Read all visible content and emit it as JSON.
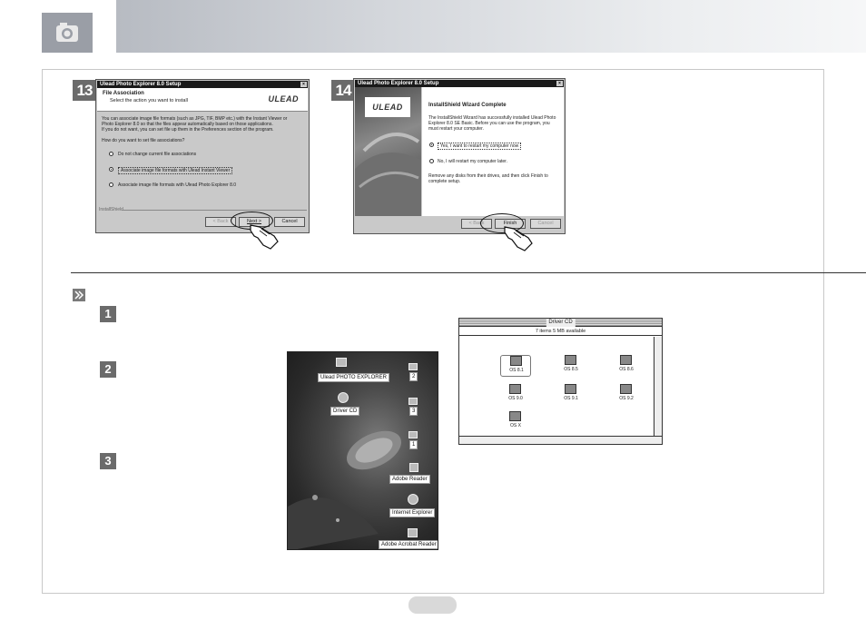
{
  "steps_top": [
    "13",
    "14"
  ],
  "steps_small": [
    "1",
    "2",
    "3"
  ],
  "dialog13": {
    "title": "Ulead Photo Explorer 8.0 Setup",
    "heading": "File Association",
    "subheading": "Select the action you want to install",
    "logo": "ULEAD",
    "body_lines": [
      "You can associate image file formats (such as JPG, TIF, BMP etc.) with the Instant Viewer or",
      "Photo Explorer 8.0 so that the files appear automatically based on those applications.",
      "If you do not want, you can set file up them in the Preferences section of the program."
    ],
    "question": "How do you want to set file associations?",
    "options": [
      "Do not change current file associations",
      "Associate image file formats with Ulead Instant Viewer",
      "Associate image file formats with Ulead Photo Explorer 8.0"
    ],
    "footer_label": "InstallShield",
    "buttons": [
      "< Back",
      "Next >",
      "Cancel"
    ]
  },
  "dialog14": {
    "title": "Ulead Photo Explorer 8.0 Setup",
    "logo": "ULEAD",
    "heading": "InstallShield Wizard Complete",
    "body_lines": [
      "The InstallShield Wizard has successfully installed Ulead Photo",
      "Explorer 8.0 SE Basic. Before you can use the program, you",
      "must restart your computer."
    ],
    "options": [
      "Yes, I want to restart my computer now",
      "No, I will restart my computer later."
    ],
    "footer_lines": [
      "Remove any disks from their drives, and then click Finish to",
      "complete setup."
    ],
    "buttons": [
      "< Back",
      "Finish",
      "Cancel"
    ]
  },
  "mac_window": {
    "title": "Driver CD",
    "info": "7 items   5 MB available",
    "folders": [
      "OS 8.1",
      "OS 8.5",
      "OS 8.6",
      "OS 9.0",
      "OS 9.1",
      "OS 9.2",
      "OS X"
    ]
  },
  "desktop": {
    "labels": [
      "Ulead PHOTO EXPLORER",
      "Driver CD",
      "Adobe Reader",
      "Internet Explorer",
      "Adobe Acrobat Reader"
    ],
    "drive_labels": [
      "2",
      "3",
      "1"
    ]
  },
  "colors": {
    "badge": "#6b6b6b",
    "header_gradient_start": "#b7bbc2"
  }
}
